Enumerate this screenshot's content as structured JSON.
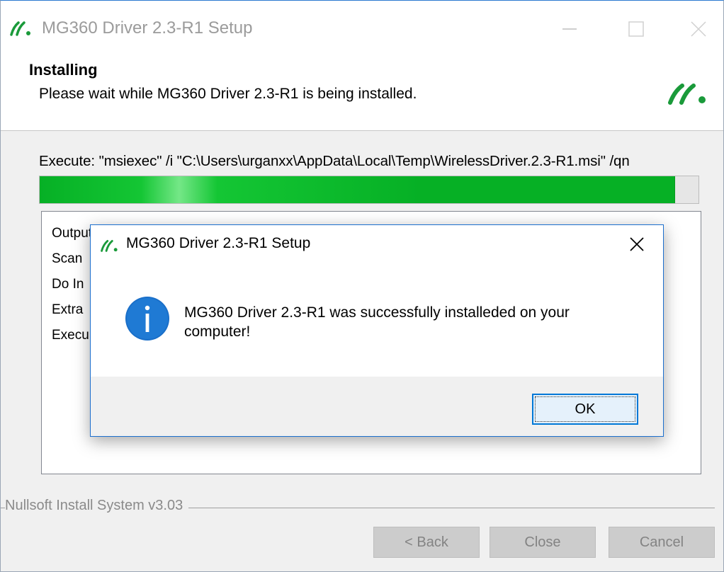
{
  "window": {
    "title": "MG360 Driver 2.3-R1 Setup",
    "icon": "wireless-logo-icon"
  },
  "header": {
    "title": "Installing",
    "subtitle": "Please wait while MG360 Driver 2.3-R1 is being installed."
  },
  "progress": {
    "status_text": "Execute: \"msiexec\" /i \"C:\\Users\\urganxx\\AppData\\Local\\Temp\\WirelessDriver.2.3-R1.msi\" /qn",
    "fraction": 0.965,
    "fill_color": "#06b025"
  },
  "details": {
    "lines": [
      "Output folder: C:\\Users\\urganxx\\AppData\\Local\\Temp",
      "Scan",
      "Do In",
      "Extra",
      "Execu"
    ]
  },
  "footer": {
    "branding": "Nullsoft Install System v3.03",
    "back_label": "< Back",
    "close_label": "Close",
    "cancel_label": "Cancel"
  },
  "dialog": {
    "title": "MG360 Driver 2.3-R1 Setup",
    "message": "MG360 Driver 2.3-R1 was successfully installeded on your computer!",
    "ok_label": "OK",
    "icon": "info-icon",
    "accent_color": "#0078d7"
  }
}
